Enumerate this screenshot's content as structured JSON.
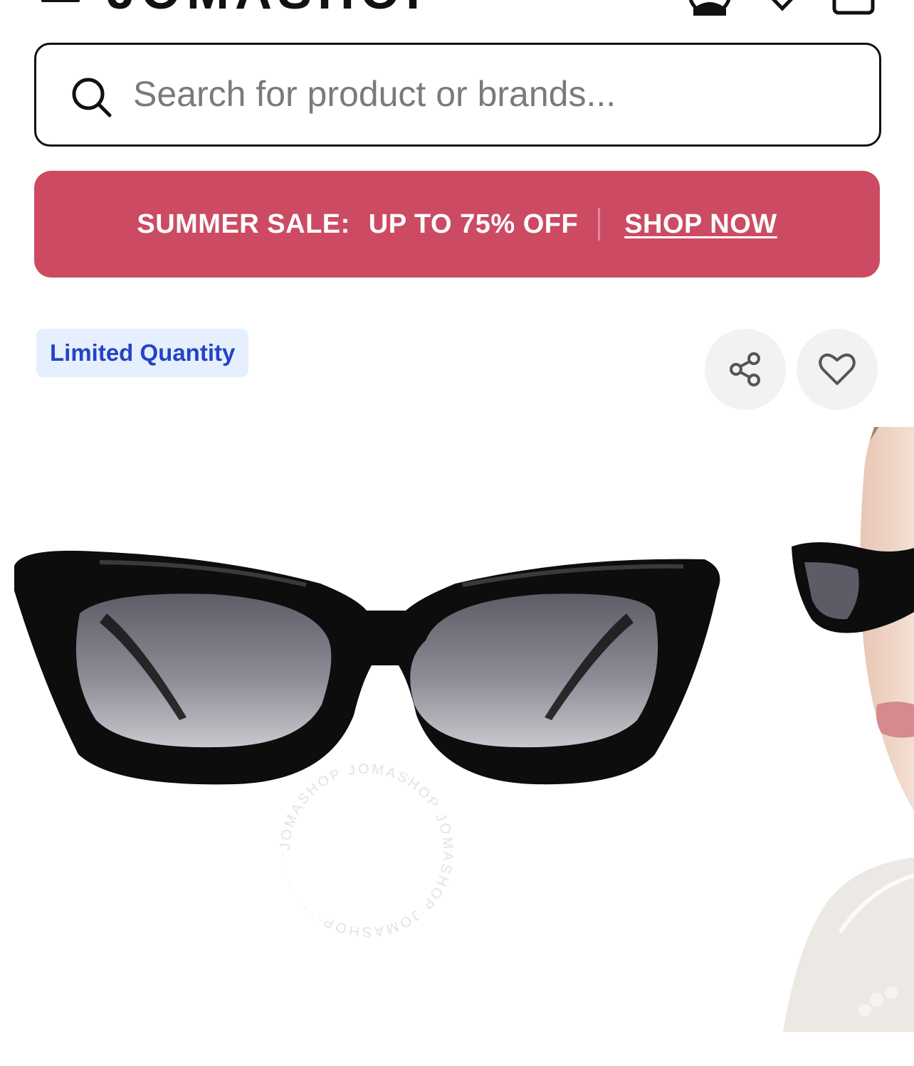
{
  "header": {
    "brand": "JOMASHOP",
    "menu_icon": "hamburger-icon",
    "account_icon": "user-icon",
    "wishlist_icon": "heart-icon",
    "cart_icon": "cart-icon"
  },
  "search": {
    "placeholder": "Search for product or brands...",
    "value": "",
    "icon": "search-icon"
  },
  "promo": {
    "label": "SUMMER SALE:",
    "offer": "UP TO 75% OFF",
    "cta": "SHOP NOW",
    "background": "#cc4b63"
  },
  "product": {
    "badge": "Limited Quantity",
    "badge_color": "#2443c4",
    "share_icon": "share-icon",
    "favorite_icon": "heart-icon",
    "watermark": "JOMASHOP JOMASHOP JOMASHOP JOMASHOP"
  }
}
